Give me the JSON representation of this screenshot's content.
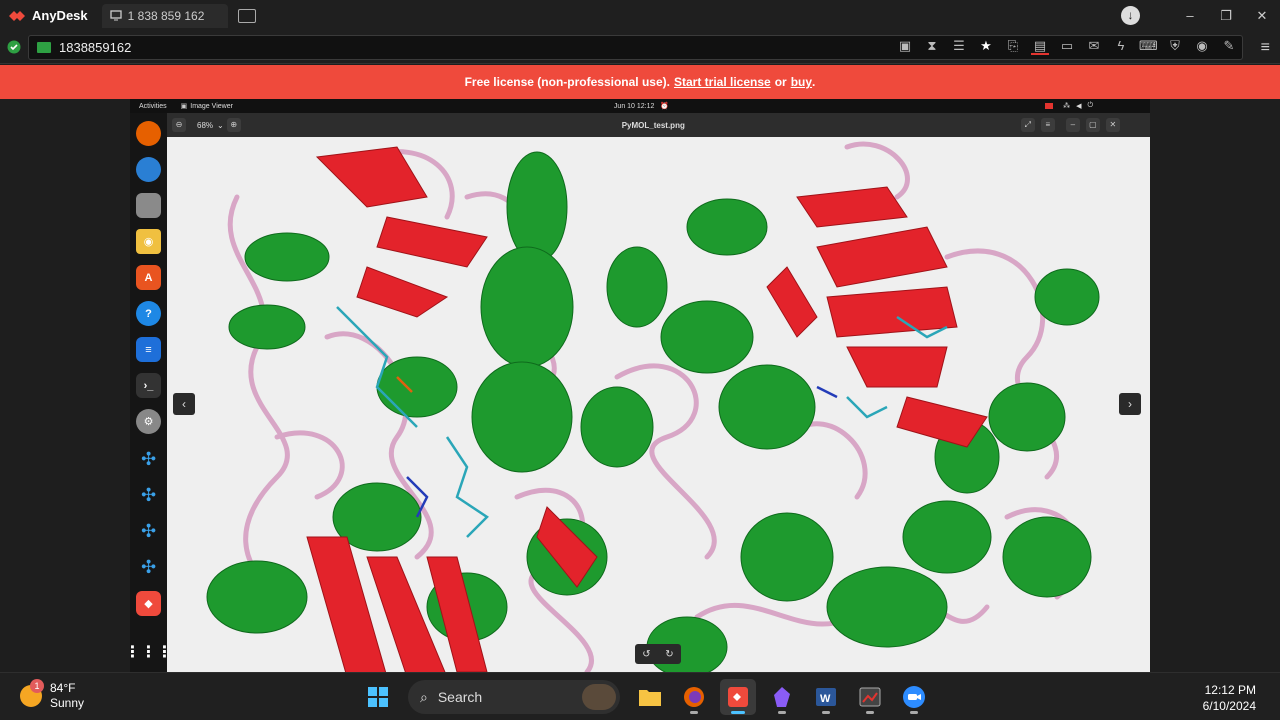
{
  "anydesk": {
    "app_name": "AnyDesk",
    "tab_label": "1 838 859 162",
    "address_value": "1838859162",
    "banner": {
      "prefix": "Free license (non-professional use).",
      "trial_link": "Start trial license",
      "middle": "or",
      "buy_link": "buy",
      "suffix": "."
    },
    "colors": {
      "accent": "#ef4a3c",
      "connected": "#2ea043"
    }
  },
  "remote": {
    "topbar": {
      "activities": "Activities",
      "app": "Image Viewer",
      "datetime": "Jun 10  12:12"
    },
    "viewer": {
      "zoom": "68%",
      "filename": "PyMOL_test.png"
    }
  },
  "taskbar": {
    "weather_temp": "84°F",
    "weather_cond": "Sunny",
    "weather_badge": "1",
    "search_label": "Search",
    "time": "12:12 PM",
    "date": "6/10/2024"
  },
  "icons": [
    "anydesk-logo-icon",
    "monitor-icon",
    "new-tab-icon",
    "download-icon",
    "connected-shield-icon",
    "firefox-icon",
    "thunderbird-icon",
    "files-icon",
    "rhythmbox-icon",
    "software-icon",
    "help-icon",
    "writer-icon",
    "terminal-icon",
    "settings-icon",
    "pymol-icon",
    "windows-start-icon",
    "search-icon",
    "file-explorer-icon",
    "word-icon",
    "zoom-icon"
  ]
}
